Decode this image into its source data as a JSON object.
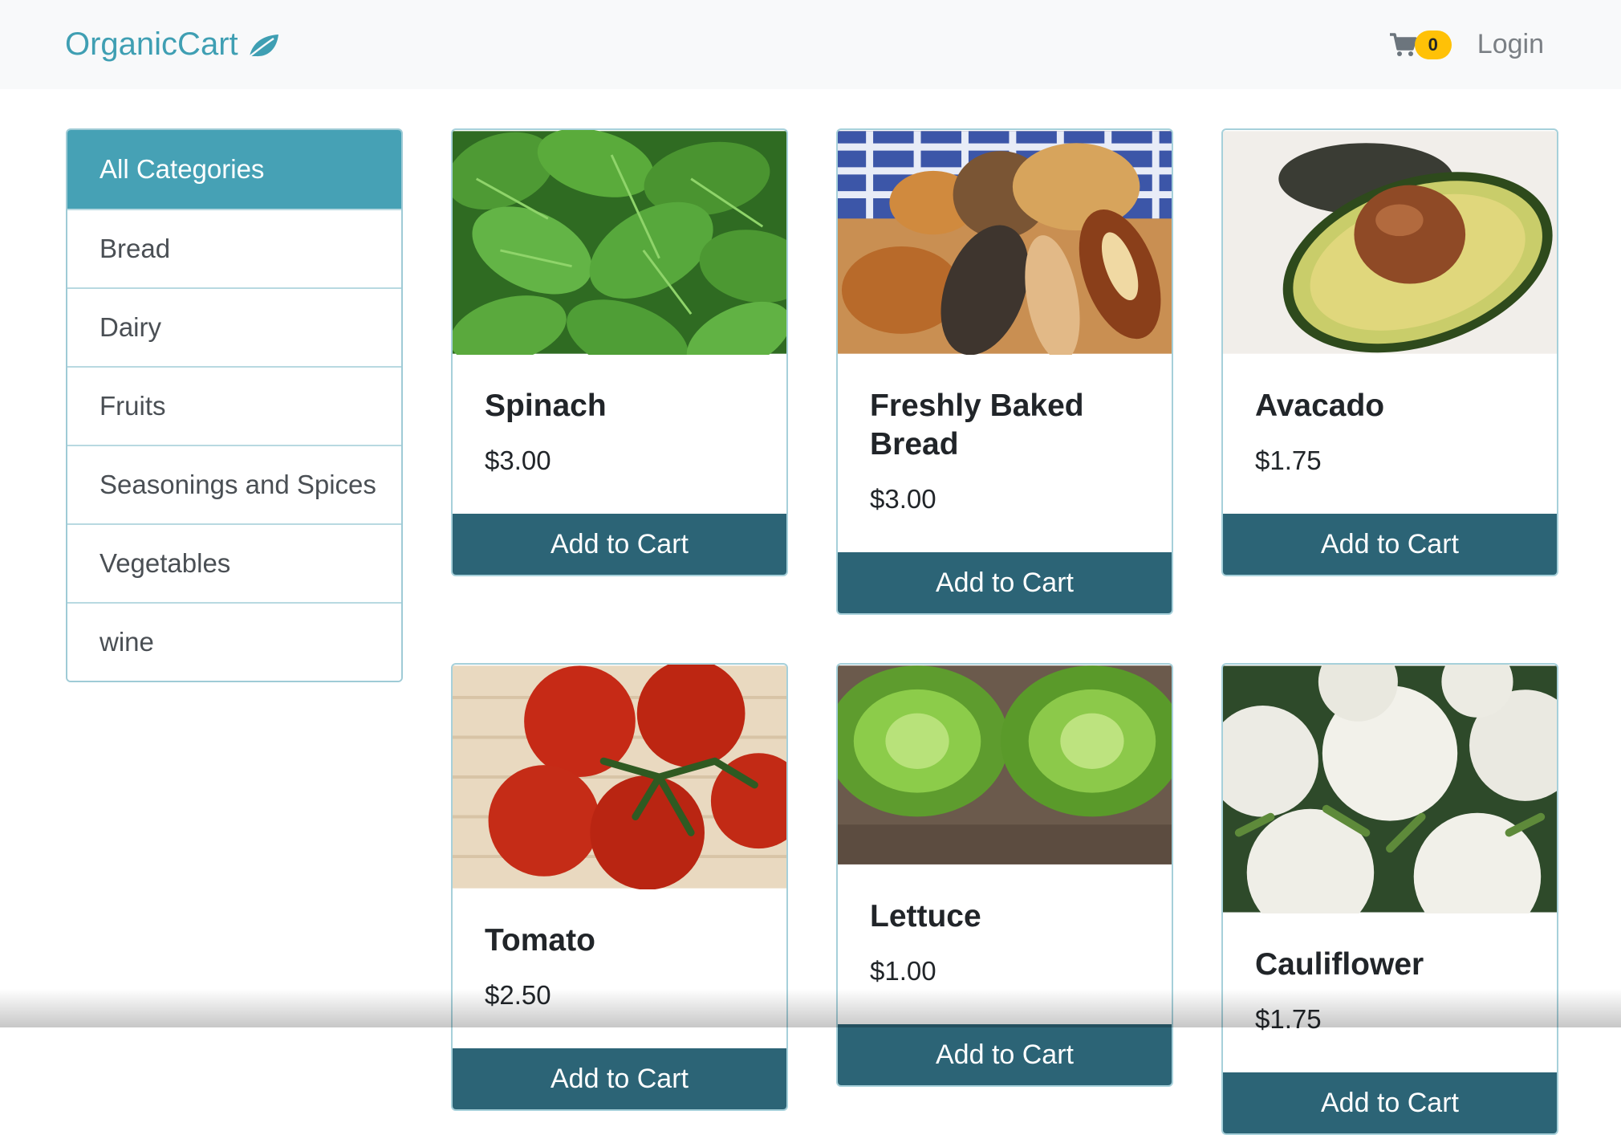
{
  "navbar": {
    "brand": "OrganicCart",
    "brand_icon": "leaf-icon",
    "cart_icon": "shopping-cart-icon",
    "cart_count": "0",
    "login_label": "Login"
  },
  "categories": [
    {
      "label": "All Categories",
      "active": true
    },
    {
      "label": "Bread",
      "active": false
    },
    {
      "label": "Dairy",
      "active": false
    },
    {
      "label": "Fruits",
      "active": false
    },
    {
      "label": "Seasonings and Spices",
      "active": false
    },
    {
      "label": "Vegetables",
      "active": false
    },
    {
      "label": "wine",
      "active": false
    }
  ],
  "products": [
    {
      "title": "Spinach",
      "price": "$3.00",
      "button": "Add to Cart",
      "image": "spinach"
    },
    {
      "title": "Freshly Baked Bread",
      "price": "$3.00",
      "button": "Add to Cart",
      "image": "bread"
    },
    {
      "title": "Avacado",
      "price": "$1.75",
      "button": "Add to Cart",
      "image": "avocado"
    },
    {
      "title": "Tomato",
      "price": "$2.50",
      "button": "Add to Cart",
      "image": "tomato"
    },
    {
      "title": "Lettuce",
      "price": "$1.00",
      "button": "Add to Cart",
      "image": "lettuce"
    },
    {
      "title": "Cauliflower",
      "price": "$1.75",
      "button": "Add to Cart",
      "image": "cauliflower"
    }
  ],
  "colors": {
    "brand": "#3f9fb3",
    "active_category": "#46a1b5",
    "button": "#2c6476",
    "badge": "#ffc107"
  }
}
